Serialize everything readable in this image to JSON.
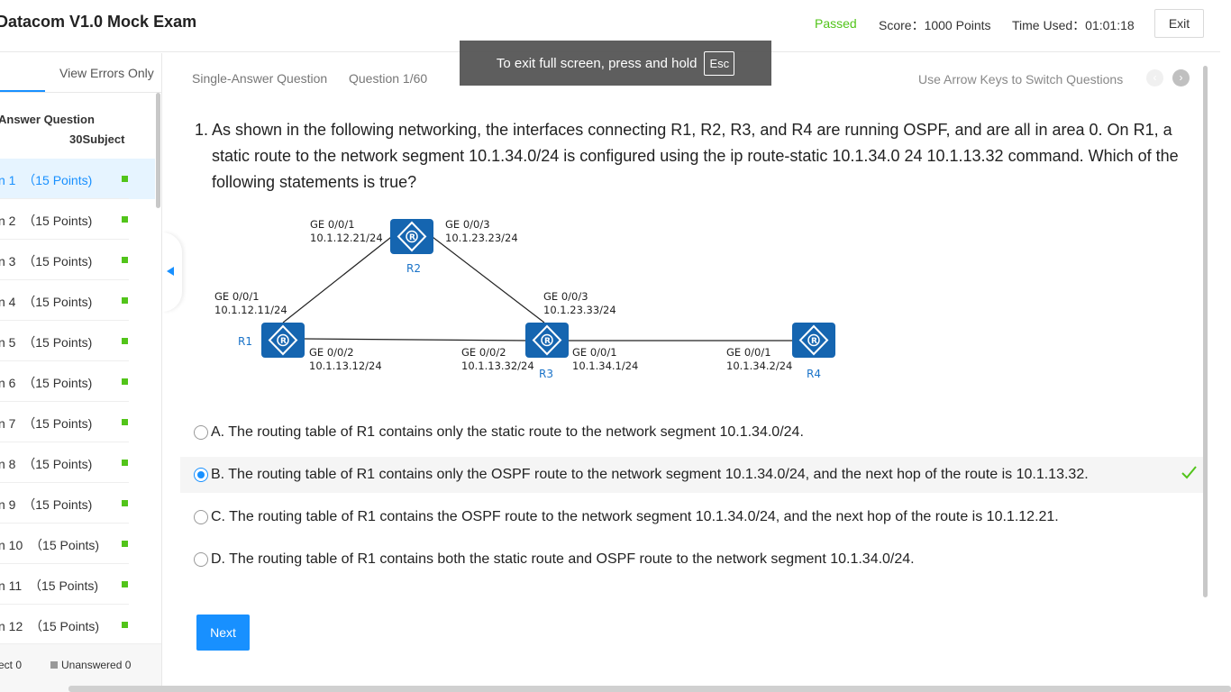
{
  "header": {
    "title": "Datacom V1.0 Mock Exam",
    "status": "Passed",
    "score": "Score：1000 Points",
    "time_used": "Time Used：01:01:18",
    "exit_label": "Exit"
  },
  "fullscreen_toast": {
    "text": "To exit full screen, press and hold",
    "key": "Esc"
  },
  "sidebar": {
    "view_errors_label": "View Errors Only",
    "section_label": "Answer Question",
    "subject_label": "30Subject",
    "items": [
      {
        "label": "n 1  （15 Points)",
        "status_color": "#52c41a"
      },
      {
        "label": "n 2  （15 Points)",
        "status_color": "#52c41a"
      },
      {
        "label": "n 3  （15 Points)",
        "status_color": "#52c41a"
      },
      {
        "label": "n 4  （15 Points)",
        "status_color": "#52c41a"
      },
      {
        "label": "n 5  （15 Points)",
        "status_color": "#52c41a"
      },
      {
        "label": "n 6  （15 Points)",
        "status_color": "#52c41a"
      },
      {
        "label": "n 7  （15 Points)",
        "status_color": "#52c41a"
      },
      {
        "label": "n 8  （15 Points)",
        "status_color": "#52c41a"
      },
      {
        "label": "n 9  （15 Points)",
        "status_color": "#52c41a"
      },
      {
        "label": "n 10  （15 Points)",
        "status_color": "#52c41a"
      },
      {
        "label": "n 11  （15 Points)",
        "status_color": "#52c41a"
      },
      {
        "label": "n 12  （15 Points)",
        "status_color": "#52c41a"
      }
    ],
    "legend_correct": "ect 0",
    "legend_unanswered": "Unanswered 0"
  },
  "question_bar": {
    "type": "Single-Answer Question",
    "number": "Question 1/60",
    "hint": "Use Arrow Keys to Switch Questions"
  },
  "question": {
    "number": "1.",
    "text": "As shown in the following networking, the interfaces connecting R1, R2, R3, and R4 are running OSPF, and are all in area 0. On R1, a static route to the network segment 10.1.34.0/24 is configured using the ip route-static 10.1.34.0 24 10.1.13.32 command. Which of the following statements is true?"
  },
  "diagram": {
    "routers": {
      "r1": "R1",
      "r2": "R2",
      "r3": "R3",
      "r4": "R4"
    },
    "interfaces": {
      "r2_left_if": "GE 0/0/1",
      "r2_left_ip": "10.1.12.21/24",
      "r2_right_if": "GE 0/0/3",
      "r2_right_ip": "10.1.23.23/24",
      "r1_top_if": "GE 0/0/1",
      "r1_top_ip": "10.1.12.11/24",
      "r1_right_if": "GE 0/0/2",
      "r1_right_ip": "10.1.13.12/24",
      "r3_top_if": "GE 0/0/3",
      "r3_top_ip": "10.1.23.33/24",
      "r3_left_if": "GE 0/0/2",
      "r3_left_ip": "10.1.13.32/24",
      "r3_right_if": "GE 0/0/1",
      "r3_right_ip": "10.1.34.1/24",
      "r4_left_if": "GE 0/0/1",
      "r4_left_ip": "10.1.34.2/24"
    }
  },
  "options": [
    {
      "text": "A. The routing table of R1 contains only the static route to the network segment 10.1.34.0/24.",
      "selected": false
    },
    {
      "text": "B. The routing table of R1 contains only the OSPF route to the network segment 10.1.34.0/24, and the next hop of the route is 10.1.13.32.",
      "selected": true,
      "correct": true
    },
    {
      "text": "C. The routing table of R1 contains the OSPF route to the network segment 10.1.34.0/24, and the next hop of the route is 10.1.12.21.",
      "selected": false
    },
    {
      "text": "D. The routing table of R1 contains both the static route and OSPF route to the network segment 10.1.34.0/24.",
      "selected": false
    }
  ],
  "next_label": "Next",
  "colors": {
    "accent": "#1890ff",
    "success": "#52c41a",
    "router_blue": "#1565b0"
  }
}
